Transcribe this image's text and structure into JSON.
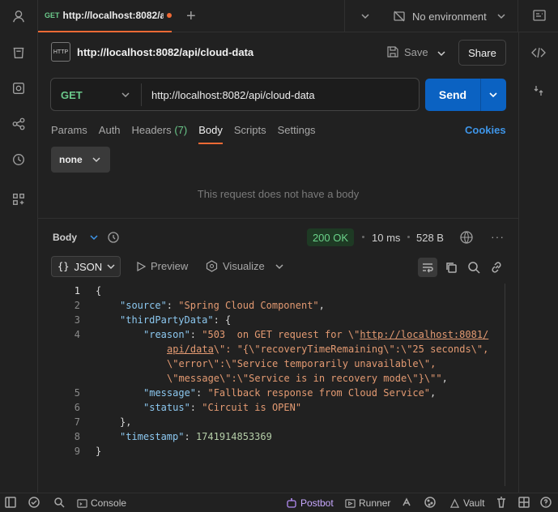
{
  "tab": {
    "method": "GET",
    "title": "http://localhost:8082/api/cloud-data"
  },
  "environment": {
    "selected": "No environment"
  },
  "request": {
    "name": "http://localhost:8082/api/cloud-data",
    "save_label": "Save",
    "share_label": "Share",
    "method": "GET",
    "url": "http://localhost:8082/api/cloud-data",
    "send_label": "Send",
    "tabs": [
      {
        "label": "Params"
      },
      {
        "label": "Auth"
      },
      {
        "label": "Headers",
        "count": "(7)"
      },
      {
        "label": "Body"
      },
      {
        "label": "Scripts"
      },
      {
        "label": "Settings"
      }
    ],
    "active_tab": "Body",
    "cookies_label": "Cookies",
    "body_type": "none",
    "body_empty_text": "This request does not have a body"
  },
  "response": {
    "body_label": "Body",
    "status": "200 OK",
    "time": "10 ms",
    "size": "528 B",
    "format": "JSON",
    "preview_label": "Preview",
    "visualize_label": "Visualize",
    "line_numbers": [
      "1",
      "2",
      "3",
      "4",
      "",
      "",
      "",
      "5",
      "6",
      "7",
      "8",
      "9"
    ],
    "json": {
      "l1": "{",
      "source_key": "\"source\"",
      "source_val": "\"Spring Cloud Component\"",
      "third_key": "\"thirdPartyData\"",
      "reason_key": "\"reason\"",
      "reason_a": "\"503  on GET request for \\\"",
      "reason_url1": "http://localhost:8081/",
      "reason_url2": "api/data",
      "reason_b": "\\\": \"{\\\"recoveryTimeRemaining\\\":\\\"25 seconds\\\",",
      "reason_c": "\\\"error\\\":\\\"Service temporarily unavailable\\\",",
      "reason_d": "\\\"message\\\":\\\"Service is in recovery mode\\\"}\\\"\"",
      "message_key": "\"message\"",
      "message_val": "\"Fallback response from Cloud Service\"",
      "status_key": "\"status\"",
      "status_val": "\"Circuit is OPEN\"",
      "timestamp_key": "\"timestamp\"",
      "timestamp_val": "1741914853369",
      "close": "}"
    }
  },
  "statusbar": {
    "console": "Console",
    "postbot": "Postbot",
    "runner": "Runner",
    "vault": "Vault"
  },
  "colors": {
    "accent": "#f06a35",
    "send": "#0b62c2",
    "get": "#6bc98b",
    "link": "#3e95e8"
  }
}
